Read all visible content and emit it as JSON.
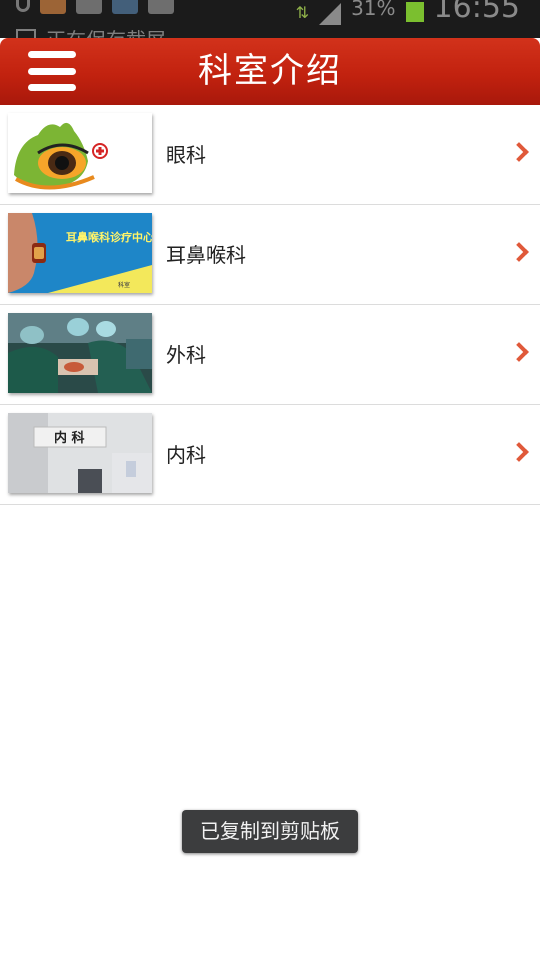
{
  "status_bar": {
    "notice": "正在保存截屏",
    "battery": "31%",
    "time": "16:55"
  },
  "header": {
    "title": "科室介绍",
    "menu_icon": "hamburger-menu-icon"
  },
  "departments": [
    {
      "label": "眼科",
      "thumb_text": ""
    },
    {
      "label": "耳鼻喉科",
      "thumb_text": "耳鼻喉科诊疗中心"
    },
    {
      "label": "外科",
      "thumb_text": ""
    },
    {
      "label": "内科",
      "thumb_text": "内 科"
    }
  ],
  "toast": {
    "text": "已复制到剪贴板"
  },
  "colors": {
    "header_red": "#c2220f",
    "chevron": "#e0593a",
    "toast_bg": "#3c3d3e"
  }
}
